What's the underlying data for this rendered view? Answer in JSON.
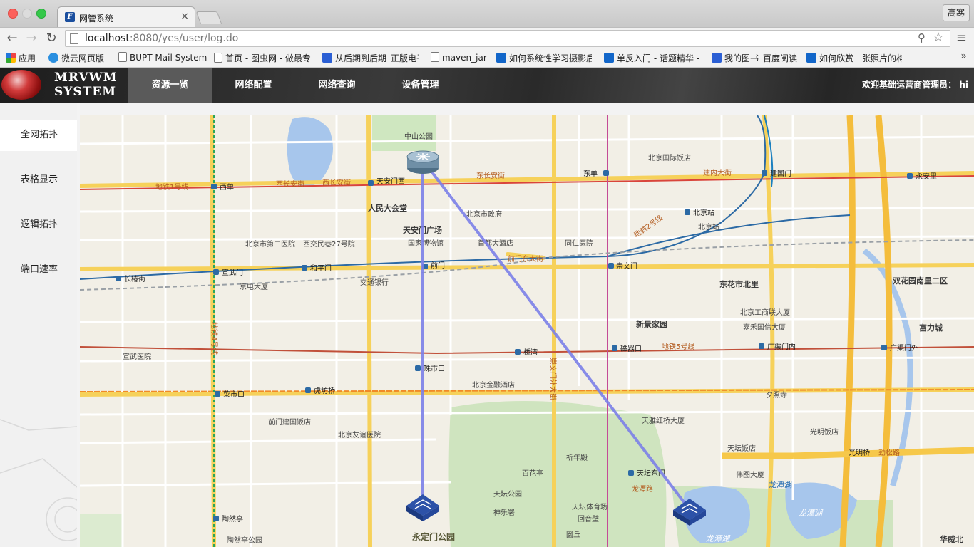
{
  "browser": {
    "tab_title": "网管系统",
    "tab_close": "×",
    "profile_label": "高寒",
    "url_host": "localhost",
    "url_rest": ":8080/yes/user/log.do",
    "bookmarks": [
      {
        "label": "应用"
      },
      {
        "label": "微云网页版"
      },
      {
        "label": "BUPT Mail System"
      },
      {
        "label": "首页 - 图虫网 - 做最专"
      },
      {
        "label": "从后期到后期_正版电子"
      },
      {
        "label": "maven_jar"
      },
      {
        "label": "如何系统性学习摄影后期"
      },
      {
        "label": "单反入门 - 话题精华 -"
      },
      {
        "label": "我的图书_百度阅读"
      },
      {
        "label": "如何欣赏一张照片的构图"
      }
    ],
    "bookmarks_more": "»"
  },
  "app": {
    "logo_line1": "MRVWM",
    "logo_line2": "SYSTEM",
    "nav": [
      {
        "label": "资源一览",
        "active": true
      },
      {
        "label": "网络配置",
        "active": false
      },
      {
        "label": "网络查询",
        "active": false
      },
      {
        "label": "设备管理",
        "active": false
      }
    ],
    "welcome": "欢迎基础运营商管理员： hi"
  },
  "sidebar": {
    "items": [
      {
        "label": "全网拓扑",
        "active": true
      },
      {
        "label": "表格显示",
        "active": false
      },
      {
        "label": "逻辑拓扑",
        "active": false
      },
      {
        "label": "端口速率",
        "active": false
      }
    ]
  },
  "map": {
    "districts": [
      "人民大会堂",
      "天安门广场",
      "东花市北里",
      "双花园南里二区",
      "新景家园",
      "富力城",
      "华威北",
      "永定门公园"
    ],
    "subway_stations": [
      "西单",
      "天安门西",
      "东单",
      "建国门",
      "永安里",
      "北京站",
      "崇文门",
      "前门",
      "和平门",
      "宣武门",
      "长椿街",
      "磁器口",
      "广渠门内",
      "广渠门外",
      "桥湾",
      "珠市口",
      "菜市口",
      "虎坊桥",
      "天坛东门",
      "陶然亭"
    ],
    "roads": [
      "地铁1号线",
      "西长安街",
      "西长安街",
      "东长安街",
      "建内大街",
      "前门东大街",
      "地铁5号线",
      "地铁4号线",
      "地铁2号线",
      "崇文门外大街",
      "光明桥",
      "劲松路",
      "龙潭路"
    ],
    "pois": [
      "中山公园",
      "北京市政府",
      "北京国际饭店",
      "北京站",
      "同仁医院",
      "首都大酒店",
      "国家博物馆",
      "交通银行",
      "京电大厦",
      "前门建国饭店",
      "北京友谊医院",
      "北京金融酒店",
      "天坛公园",
      "祈年殿",
      "百花亭",
      "神乐署",
      "回音壁",
      "圜丘",
      "天坛体育场",
      "龙潭湖",
      "伟图大厦",
      "天坛饭店",
      "天雅红桥大厦",
      "夕照寺",
      "光明饭店",
      "北京工商联大厦",
      "嘉禾国信大厦",
      "北京市第二医院",
      "西交民巷27号院",
      "宣武医院",
      "陶然亭公园"
    ],
    "lakes": [
      "龙潭湖",
      "龙潭湖"
    ],
    "devices": [
      {
        "name": "router-tiananmen",
        "type": "router"
      },
      {
        "name": "switch-yongdingmen",
        "type": "switch"
      },
      {
        "name": "switch-longtanhu",
        "type": "switch"
      }
    ],
    "link_color": "#7b7fe8"
  }
}
